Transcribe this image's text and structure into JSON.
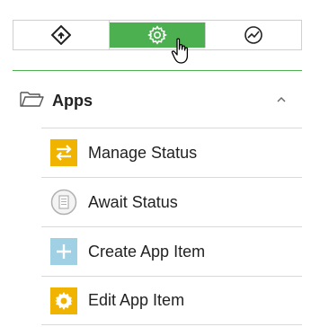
{
  "toolbar": {
    "tabs": [
      {
        "icon": "diamond-arrow-icon"
      },
      {
        "icon": "gear-icon",
        "active": true
      },
      {
        "icon": "chart-icon"
      }
    ]
  },
  "section": {
    "title": "Apps",
    "icon": "folder-open-icon",
    "toggle_icon": "chevron-up-icon"
  },
  "items": [
    {
      "label": "Manage Status",
      "icon": "swap-arrows-icon",
      "color": "#f0b400"
    },
    {
      "label": "Await Status",
      "icon": "document-icon",
      "color": "#b0b0b0"
    },
    {
      "label": "Create App Item",
      "icon": "plus-icon",
      "color": "#9fd0e3"
    },
    {
      "label": "Edit App Item",
      "icon": "gear-icon",
      "color": "#f0b400"
    }
  ],
  "colors": {
    "accent": "#4caf50"
  }
}
